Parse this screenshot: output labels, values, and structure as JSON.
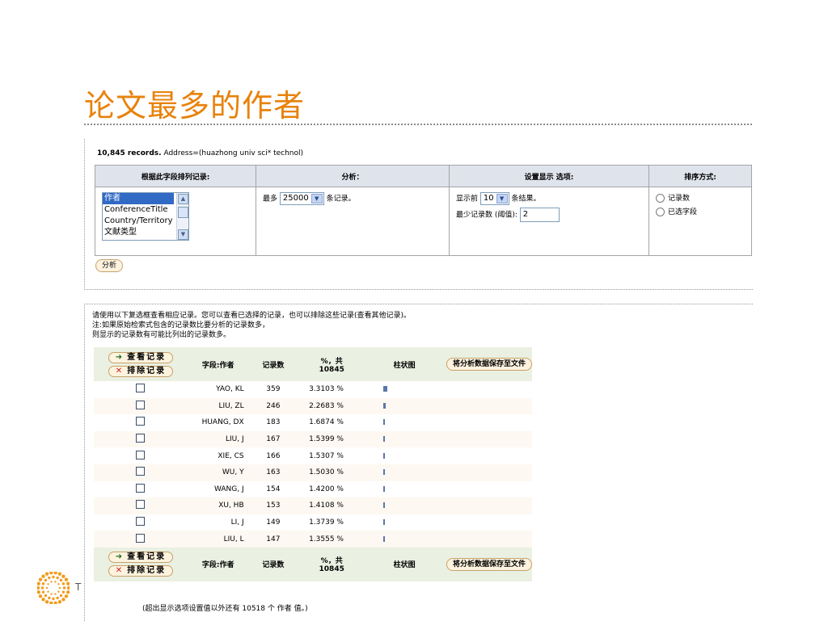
{
  "slide": {
    "title": "论文最多的作者",
    "logo_fragment": "T"
  },
  "summary": {
    "records": "10,845 records.",
    "query": "Address=(huazhong univ sci* technol)"
  },
  "options": {
    "headers": [
      "根据此字段排列记录:",
      "分析：",
      "设置显示 选项:",
      "排序方式:"
    ],
    "field_list": [
      "作者",
      "ConferenceTitle",
      "Country/Territory",
      "文献类型"
    ],
    "field_selected": "作者",
    "analyze_prefix": "最多",
    "analyze_value": "25000",
    "analyze_suffix": "条记录。",
    "show_prefix": "显示前",
    "show_value": "10",
    "show_suffix": "条结果。",
    "min_label": "最少记录数 (阈值):",
    "min_value": "2",
    "sort_options": [
      "记录数",
      "已选字段"
    ]
  },
  "analyze_button": "分析",
  "instructions": [
    "请使用以下复选框查看相应记录。您可以查看已选择的记录，也可以排除这些记录(查看其他记录)。",
    "注:如果原始检索式包含的记录数比要分析的记录数多，",
    "则显示的记录数有可能比列出的记录数多。"
  ],
  "results": {
    "view_button": "查看记录",
    "exclude_button": "排除记录",
    "columns": {
      "field": "字段:作者",
      "count": "记录数",
      "percent": "%，共10845",
      "bar": "柱状图"
    },
    "save_button": "将分析数据保存至文件",
    "rows": [
      {
        "name": "YAO, KL",
        "count": "359",
        "percent": "3.3103 %",
        "bar": 3.3103
      },
      {
        "name": "LIU, ZL",
        "count": "246",
        "percent": "2.2683 %",
        "bar": 2.2683
      },
      {
        "name": "HUANG, DX",
        "count": "183",
        "percent": "1.6874 %",
        "bar": 1.6874
      },
      {
        "name": "LIU, J",
        "count": "167",
        "percent": "1.5399 %",
        "bar": 1.5399
      },
      {
        "name": "XIE, CS",
        "count": "166",
        "percent": "1.5307 %",
        "bar": 1.5307
      },
      {
        "name": "WU, Y",
        "count": "163",
        "percent": "1.5030 %",
        "bar": 1.503
      },
      {
        "name": "WANG, J",
        "count": "154",
        "percent": "1.4200 %",
        "bar": 1.42
      },
      {
        "name": "XU, HB",
        "count": "153",
        "percent": "1.4108 %",
        "bar": 1.4108
      },
      {
        "name": "LI, J",
        "count": "149",
        "percent": "1.3739 %",
        "bar": 1.3739
      },
      {
        "name": "LIU, L",
        "count": "147",
        "percent": "1.3555 %",
        "bar": 1.3555
      }
    ],
    "footnote": "(超出显示选项设置值以外还有 10518 个 作者 值。)"
  },
  "colors": {
    "title": "#e8820c",
    "bar": "#5a78a8",
    "header_bg": "#dfe3ec",
    "result_header_bg": "#eaf0e2"
  }
}
